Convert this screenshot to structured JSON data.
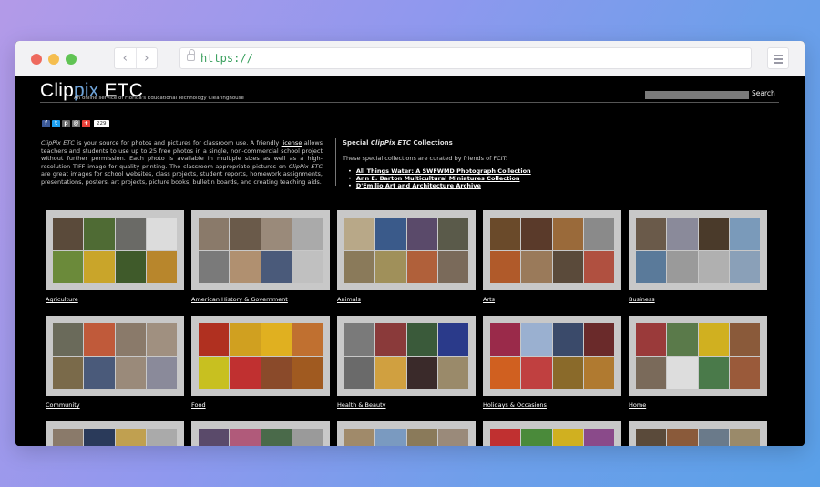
{
  "browser": {
    "url": "https://",
    "back_icon": "chevron-left-icon",
    "forward_icon": "chevron-right-icon",
    "menu_icon": "hamburger-icon"
  },
  "site": {
    "logo_clip": "Clip",
    "logo_pix": "pix",
    "logo_etc": " ETC",
    "tagline": "An online service of Florida's Educational Technology Clearinghouse",
    "search_button": "Search",
    "share_count": "229"
  },
  "intro": {
    "part1_em": "ClipPix ETC",
    "part1": " is your source for photos and pictures for classroom use. A friendly ",
    "license": "license",
    "part2": " allows teachers and students to use up to 25 free photos in a single, non-commercial school project without further permission. Each photo is available in multiple sizes as well as a high-resolution TIFF image for quality printing. The classroom-appropriate pictures on ",
    "part2_em": "ClipPix ETC",
    "part3": " are great images for school websites, class projects, student reports, homework assignments, presentations, posters, art projects, picture books, bulletin boards, and creating teaching aids."
  },
  "special": {
    "heading_pre": "Special ",
    "heading_em": "ClipPix ETC",
    "heading_post": " Collections",
    "text": "These special collections are curated by friends of FCIT:",
    "links": [
      "All Things Water: A SWFWMD Photograph Collection",
      "Ann E. Barton Multicultural Miniatures Collection",
      "D'Emilio Art and Architecture Archive"
    ]
  },
  "categories": [
    {
      "label": "Agriculture",
      "colors": [
        "#5a4a3a",
        "#4f6b34",
        "#6a6a66",
        "#dcdcdc",
        "#6b8a3a",
        "#c9a52a",
        "#3f5a2a",
        "#b8862c"
      ]
    },
    {
      "label": "American History & Government",
      "colors": [
        "#8a7a6a",
        "#6a5a4a",
        "#9a8a7a",
        "#aaaaaa",
        "#7a7a7a",
        "#b09070",
        "#4a5a7a",
        "#c0c0c0"
      ]
    },
    {
      "label": "Animals",
      "colors": [
        "#b8a888",
        "#3a5a8a",
        "#5a4a6a",
        "#5a5a4a",
        "#8a7a5a",
        "#a0905a",
        "#b0603a",
        "#7a6a5a"
      ]
    },
    {
      "label": "Arts",
      "colors": [
        "#6a4a2a",
        "#5a3a2a",
        "#9a6a3a",
        "#8a8a8a",
        "#b05a2a",
        "#9a7a5a",
        "#5a4a3a",
        "#b05040"
      ]
    },
    {
      "label": "Business",
      "colors": [
        "#6a5a4a",
        "#8a8a9a",
        "#4a3a2a",
        "#7a9aba",
        "#5a7a9a",
        "#9a9a9a",
        "#b0b0b0",
        "#8aa0b8"
      ]
    },
    {
      "label": "Community",
      "colors": [
        "#6a6a5a",
        "#c05a3a",
        "#8a7a6a",
        "#a09080",
        "#7a6a4a",
        "#4a5a7a",
        "#9a8a7a",
        "#8a8a9a"
      ]
    },
    {
      "label": "Food",
      "colors": [
        "#b03020",
        "#d0a020",
        "#e0b020",
        "#c07030",
        "#c8c020",
        "#c03030",
        "#8a4a2a",
        "#a05a20"
      ]
    },
    {
      "label": "Health & Beauty",
      "colors": [
        "#7a7a7a",
        "#8a3a3a",
        "#3a5a3a",
        "#2a3a8a",
        "#6a6a6a",
        "#d0a040",
        "#3a2a2a",
        "#9a8a6a"
      ]
    },
    {
      "label": "Holidays & Occasions",
      "colors": [
        "#9a2a4a",
        "#9ab0d0",
        "#3a4a6a",
        "#6a2a2a",
        "#d06020",
        "#c04040",
        "#8a6a2a",
        "#b07a30"
      ]
    },
    {
      "label": "Home",
      "colors": [
        "#9a3a3a",
        "#5a7a4a",
        "#d0b020",
        "#8a5a3a",
        "#7a6a5a",
        "#dddddd",
        "#4a7a4a",
        "#9a5a3a"
      ]
    },
    {
      "label": "",
      "colors": [
        "#8a7a6a",
        "#2a3a5a",
        "#c0a050",
        "#aaaaaa",
        "#8a7a6a",
        "#2a3a5a",
        "#c0a050",
        "#aaaaaa"
      ]
    },
    {
      "label": "",
      "colors": [
        "#5a4a6a",
        "#b05a7a",
        "#4a6a4a",
        "#9a9a9a",
        "#5a4a6a",
        "#b05a7a",
        "#4a6a4a",
        "#9a9a9a"
      ]
    },
    {
      "label": "",
      "colors": [
        "#a08a6a",
        "#7a9ac0",
        "#8a7a5a",
        "#9a8a7a",
        "#a08a6a",
        "#7a9ac0",
        "#8a7a5a",
        "#9a8a7a"
      ]
    },
    {
      "label": "",
      "colors": [
        "#c03030",
        "#4a8a3a",
        "#d0b020",
        "#8a4a8a",
        "#c03030",
        "#4a8a3a",
        "#d0b020",
        "#8a4a8a"
      ]
    },
    {
      "label": "",
      "colors": [
        "#5a4a3a",
        "#8a5a3a",
        "#6a7a8a",
        "#9a8a6a",
        "#5a4a3a",
        "#8a5a3a",
        "#6a7a8a",
        "#9a8a6a"
      ]
    }
  ]
}
